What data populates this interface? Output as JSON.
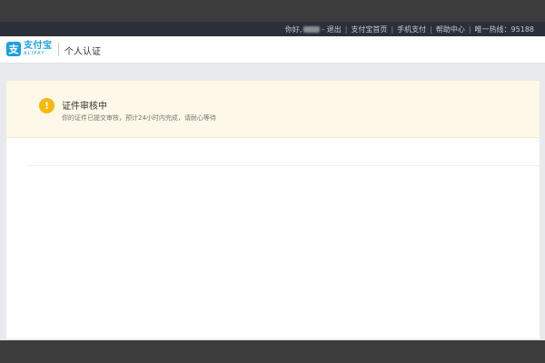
{
  "topbar": {
    "greeting": "你好,",
    "logout": "- 退出",
    "home": "支付宝首页",
    "mobile_pay": "手机支付",
    "help": "帮助中心",
    "hotline": "唯一热线：95188"
  },
  "header": {
    "logo_cn": "支付宝",
    "logo_en": "ALIPAY",
    "logo_glyph": "支",
    "page_title": "个人认证"
  },
  "notice": {
    "icon": "warning-icon",
    "icon_glyph": "!",
    "title": "证件审核中",
    "description": "你的证件已提交审核，预计24小时内完成，请耐心等待"
  },
  "colors": {
    "brand": "#1a9fe8",
    "warning": "#f6b90c",
    "notice_bg": "#fdf8e7",
    "topbar_bg": "#2b2f3a"
  }
}
